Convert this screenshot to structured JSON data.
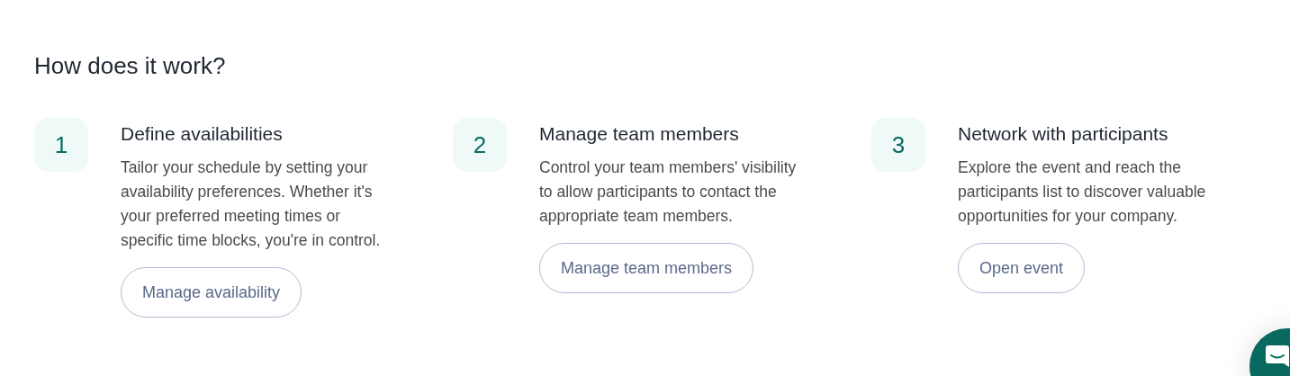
{
  "heading": "How does it work?",
  "steps": [
    {
      "number": "1",
      "title": "Define availabilities",
      "text": "Tailor your schedule by setting your availability preferences. Whether it's your preferred meeting times or specific time blocks, you're in control.",
      "button": "Manage availability"
    },
    {
      "number": "2",
      "title": "Manage team members",
      "text": "Control your team members' visibility to allow participants to contact the appropriate team members.",
      "button": "Manage team members"
    },
    {
      "number": "3",
      "title": "Network with participants",
      "text": "Explore the event and reach the participants list to discover valuable opportunities for your company.",
      "button": "Open event"
    }
  ]
}
